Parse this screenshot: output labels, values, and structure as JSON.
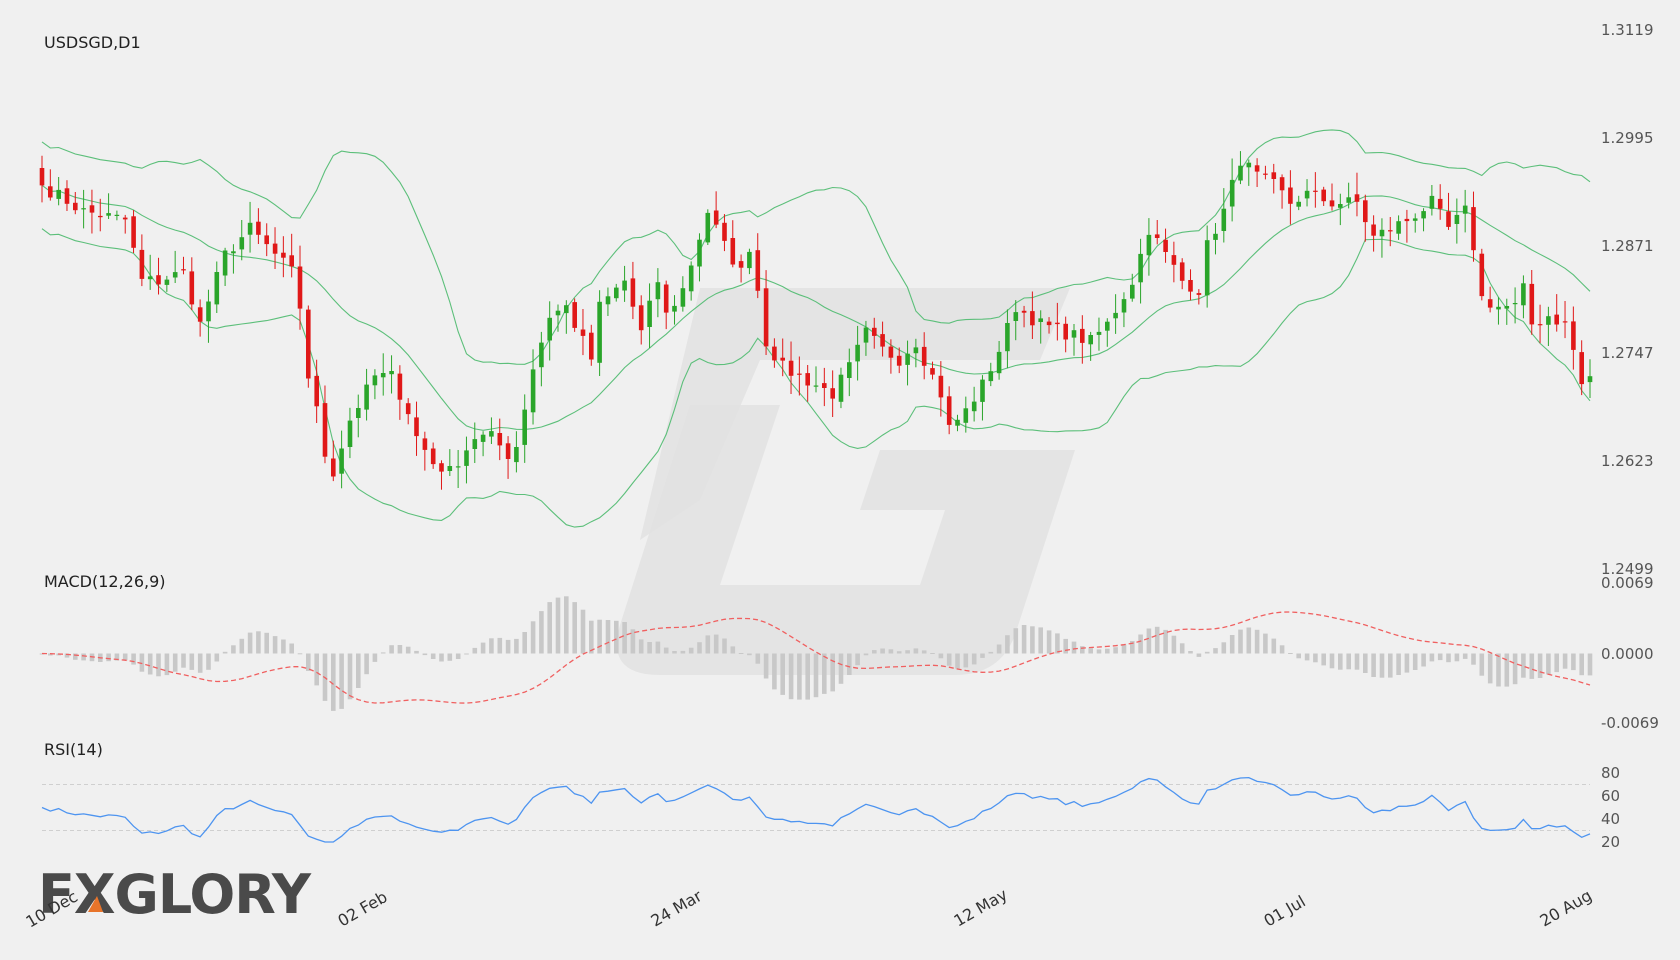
{
  "chart_title": "USDSGD,D1",
  "brand": {
    "text": "FXGLORY",
    "text_color": "#4a4a4a",
    "accent_color": "#e8742a"
  },
  "colors": {
    "bull": "#2aa52a",
    "bear": "#e01818",
    "bands": "#5cbf7a",
    "macd_signal": "#f06060",
    "macd_hist": "#c8c8c8",
    "rsi": "#4d94f0",
    "background": "#f0f0f0",
    "watermark": "#e2e2e2"
  },
  "price_axis": {
    "ticks": [
      "1.3119",
      "1.2995",
      "1.2871",
      "1.2747",
      "1.2623",
      "1.2499"
    ]
  },
  "macd_axis": {
    "ticks": [
      "0.0069",
      "0.0000",
      "-0.0069"
    ]
  },
  "rsi_axis": {
    "ticks": [
      "80",
      "60",
      "40",
      "20"
    ]
  },
  "x_labels": [
    "10 Dec",
    "02 Feb",
    "24 Mar",
    "12 May",
    "01 Jul",
    "20 Aug"
  ],
  "chart_data": [
    {
      "type": "candlestick",
      "title": "USDSGD,D1",
      "ylim": [
        1.2499,
        1.3119
      ],
      "overlay": "Bollinger Bands",
      "anchors_close": [
        [
          0,
          1.294
        ],
        [
          5,
          1.291
        ],
        [
          10,
          1.29
        ],
        [
          12,
          1.283
        ],
        [
          14,
          1.283
        ],
        [
          17,
          1.284
        ],
        [
          19,
          1.278
        ],
        [
          22,
          1.286
        ],
        [
          25,
          1.289
        ],
        [
          27,
          1.287
        ],
        [
          30,
          1.284
        ],
        [
          31,
          1.28
        ],
        [
          32,
          1.272
        ],
        [
          33,
          1.268
        ],
        [
          34,
          1.263
        ],
        [
          35,
          1.261
        ],
        [
          37,
          1.267
        ],
        [
          40,
          1.272
        ],
        [
          42,
          1.272
        ],
        [
          44,
          1.268
        ],
        [
          45,
          1.265
        ],
        [
          47,
          1.262
        ],
        [
          49,
          1.261
        ],
        [
          52,
          1.265
        ],
        [
          54,
          1.265
        ],
        [
          56,
          1.263
        ],
        [
          57,
          1.264
        ],
        [
          59,
          1.273
        ],
        [
          61,
          1.279
        ],
        [
          63,
          1.28
        ],
        [
          64,
          1.278
        ],
        [
          66,
          1.274
        ],
        [
          67,
          1.28
        ],
        [
          70,
          1.283
        ],
        [
          72,
          1.277
        ],
        [
          74,
          1.283
        ],
        [
          75,
          1.279
        ],
        [
          77,
          1.282
        ],
        [
          80,
          1.291
        ],
        [
          82,
          1.287
        ],
        [
          84,
          1.284
        ],
        [
          85,
          1.287
        ],
        [
          86,
          1.282
        ],
        [
          87,
          1.276
        ],
        [
          89,
          1.273
        ],
        [
          91,
          1.272
        ],
        [
          93,
          1.271
        ],
        [
          95,
          1.27
        ],
        [
          97,
          1.273
        ],
        [
          99,
          1.277
        ],
        [
          101,
          1.275
        ],
        [
          103,
          1.274
        ],
        [
          105,
          1.276
        ],
        [
          107,
          1.272
        ],
        [
          108,
          1.27
        ],
        [
          109,
          1.266
        ],
        [
          111,
          1.268
        ],
        [
          113,
          1.271
        ],
        [
          115,
          1.275
        ],
        [
          117,
          1.28
        ],
        [
          120,
          1.278
        ],
        [
          123,
          1.277
        ],
        [
          126,
          1.276
        ],
        [
          128,
          1.278
        ],
        [
          131,
          1.283
        ],
        [
          133,
          1.289
        ],
        [
          135,
          1.286
        ],
        [
          137,
          1.283
        ],
        [
          139,
          1.282
        ],
        [
          140,
          1.287
        ],
        [
          142,
          1.291
        ],
        [
          144,
          1.297
        ],
        [
          146,
          1.295
        ],
        [
          148,
          1.294
        ],
        [
          150,
          1.292
        ],
        [
          152,
          1.293
        ],
        [
          155,
          1.292
        ],
        [
          158,
          1.292
        ],
        [
          160,
          1.288
        ],
        [
          162,
          1.289
        ],
        [
          164,
          1.29
        ],
        [
          167,
          1.292
        ],
        [
          169,
          1.289
        ],
        [
          171,
          1.291
        ],
        [
          172,
          1.287
        ],
        [
          173,
          1.281
        ],
        [
          175,
          1.28
        ],
        [
          177,
          1.28
        ],
        [
          178,
          1.282
        ],
        [
          179,
          1.278
        ],
        [
          181,
          1.279
        ],
        [
          183,
          1.278
        ],
        [
          184,
          1.275
        ],
        [
          185,
          1.271
        ],
        [
          186,
          1.272
        ]
      ],
      "candles_approx": "187 daily candles reconstructed from anchor closes",
      "x_labels": [
        "10 Dec",
        "02 Feb",
        "24 Mar",
        "12 May",
        "01 Jul",
        "20 Aug"
      ]
    },
    {
      "type": "bar",
      "title": "MACD(12,26,9)",
      "ylim": [
        -0.0069,
        0.0069
      ],
      "series": [
        {
          "name": "",
          "values": "histogram = MACD - signal (dashed line)"
        }
      ]
    },
    {
      "type": "line",
      "title": "RSI(14)",
      "ylim": [
        20,
        80
      ],
      "levels": [
        30,
        70
      ]
    }
  ]
}
